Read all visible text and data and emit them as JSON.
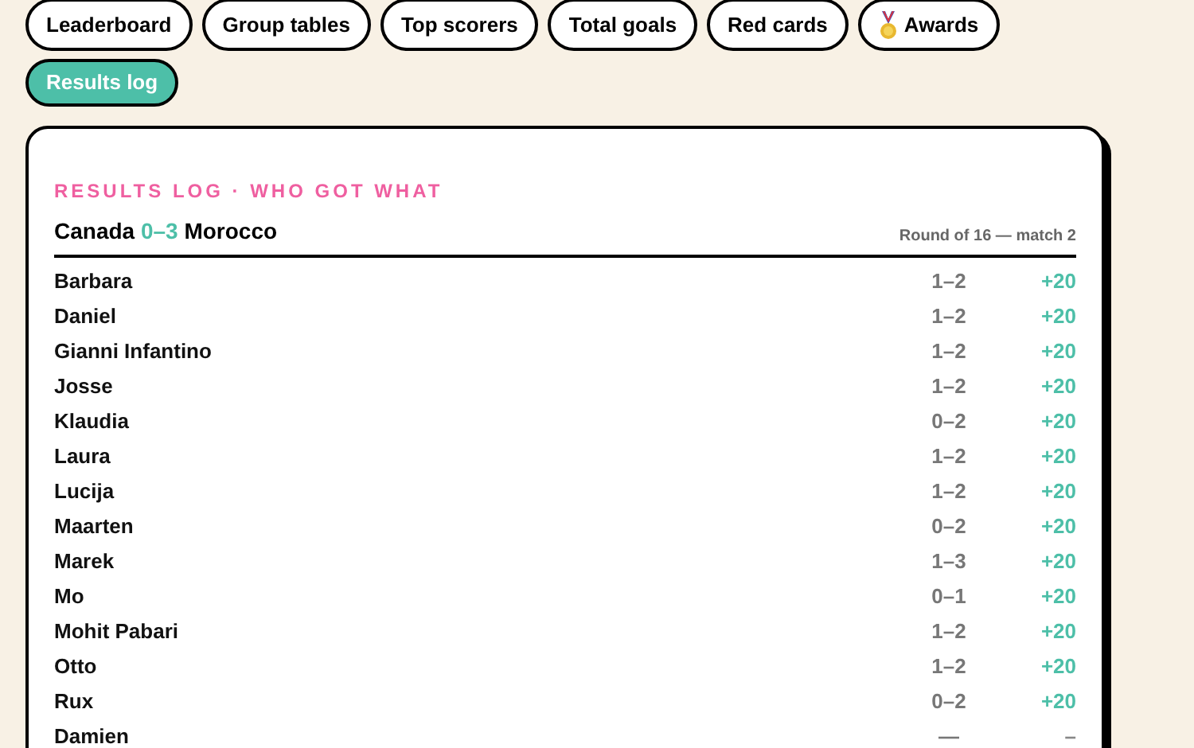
{
  "tabs": [
    {
      "label": "Leaderboard",
      "selected": false,
      "kind": "plain"
    },
    {
      "label": "Group tables",
      "selected": false,
      "kind": "plain"
    },
    {
      "label": "Top scorers",
      "selected": false,
      "kind": "plain"
    },
    {
      "label": "Total goals",
      "selected": false,
      "kind": "plain"
    },
    {
      "label": "Red cards",
      "selected": false,
      "kind": "plain"
    },
    {
      "label": "Awards",
      "selected": false,
      "kind": "medal"
    },
    {
      "label": "Results log",
      "selected": true,
      "kind": "plain"
    }
  ],
  "card": {
    "heading": "RESULTS LOG · WHO GOT WHAT",
    "match": {
      "home": "Canada",
      "score": "0–3",
      "away": "Morocco",
      "stage": "Round of 16 — match 2"
    },
    "rows": [
      {
        "name": "Barbara",
        "prediction": "1–2",
        "points": "+20",
        "kind": "scored"
      },
      {
        "name": "Daniel",
        "prediction": "1–2",
        "points": "+20",
        "kind": "scored"
      },
      {
        "name": "Gianni Infantino",
        "prediction": "1–2",
        "points": "+20",
        "kind": "scored"
      },
      {
        "name": "Josse",
        "prediction": "1–2",
        "points": "+20",
        "kind": "scored"
      },
      {
        "name": "Klaudia",
        "prediction": "0–2",
        "points": "+20",
        "kind": "scored"
      },
      {
        "name": "Laura",
        "prediction": "1–2",
        "points": "+20",
        "kind": "scored"
      },
      {
        "name": "Lucija",
        "prediction": "1–2",
        "points": "+20",
        "kind": "scored"
      },
      {
        "name": "Maarten",
        "prediction": "0–2",
        "points": "+20",
        "kind": "scored"
      },
      {
        "name": "Marek",
        "prediction": "1–3",
        "points": "+20",
        "kind": "scored"
      },
      {
        "name": "Mo",
        "prediction": "0–1",
        "points": "+20",
        "kind": "scored"
      },
      {
        "name": "Mohit Pabari",
        "prediction": "1–2",
        "points": "+20",
        "kind": "scored"
      },
      {
        "name": "Otto",
        "prediction": "1–2",
        "points": "+20",
        "kind": "scored"
      },
      {
        "name": "Rux",
        "prediction": "0–2",
        "points": "+20",
        "kind": "scored"
      },
      {
        "name": "Damien",
        "prediction": "—",
        "points": "–",
        "kind": "none"
      }
    ]
  }
}
